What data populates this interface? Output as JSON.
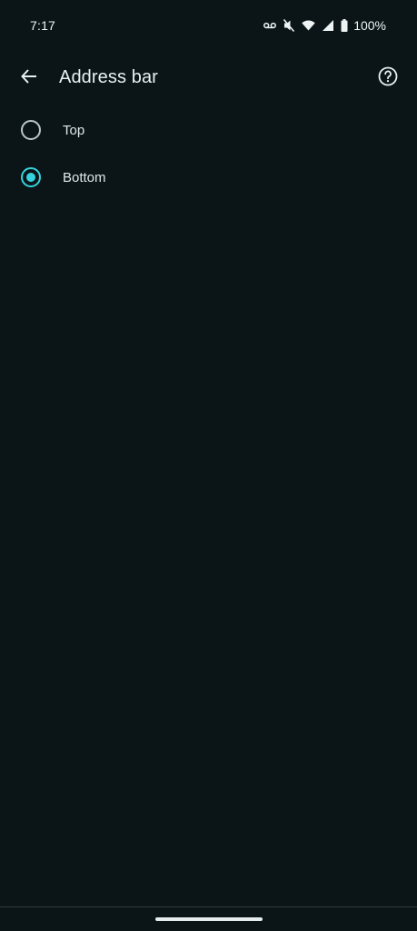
{
  "status_bar": {
    "time": "7:17",
    "battery_percent": "100%",
    "icons": [
      "voicemail-icon",
      "mute-icon",
      "wifi-icon",
      "signal-icon",
      "battery-icon"
    ]
  },
  "app_bar": {
    "title": "Address bar",
    "back_icon": "arrow-back-icon",
    "help_icon": "help-circle-icon"
  },
  "options": [
    {
      "label": "Top",
      "selected": false
    },
    {
      "label": "Bottom",
      "selected": true
    }
  ],
  "colors": {
    "background": "#0b1518",
    "accent": "#35d3de",
    "text": "#e7efef",
    "radio_unselected": "#b9c6c7"
  }
}
